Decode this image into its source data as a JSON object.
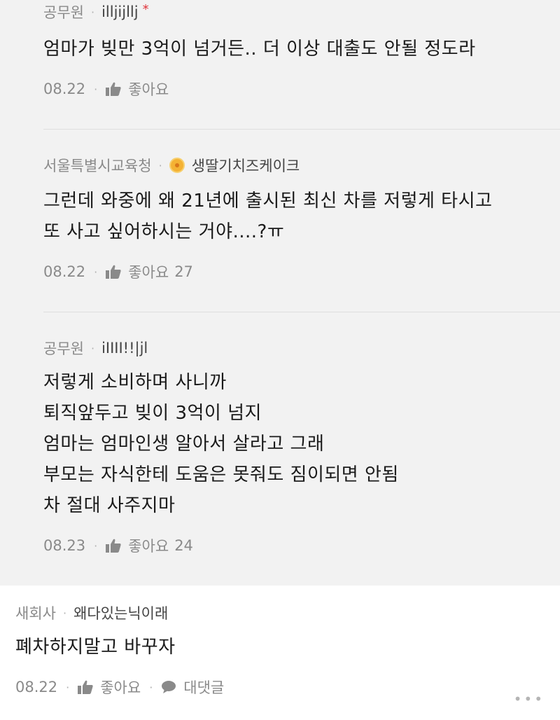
{
  "replies": [
    {
      "org": "공무원",
      "nickname": "illjijllj",
      "star": "*",
      "lines": [
        "엄마가 빚만 3억이 넘거든.. 더 이상 대출도 안될 정도라"
      ],
      "date": "08.22",
      "like_label": "좋아요",
      "like_count": ""
    },
    {
      "org": "서울특별시교육청",
      "nickname": "생딸기치즈케이크",
      "lines": [
        "그런데 와중에 왜 21년에 출시된 최신 차를 저렇게 타시고",
        "또 사고 싶어하시는 거야....?ㅠ"
      ],
      "date": "08.22",
      "like_label": "좋아요",
      "like_count": "27"
    },
    {
      "org": "공무원",
      "nickname": "iIIII!!|jl",
      "lines": [
        "저렇게 소비하며 사니까",
        "퇴직앞두고 빚이 3억이 넘지",
        "엄마는 엄마인생 알아서 살라고 그래",
        "부모는 자식한테 도움은 못줘도 짐이되면 안됨",
        "차 절대 사주지마"
      ],
      "date": "08.23",
      "like_label": "좋아요",
      "like_count": "24"
    }
  ],
  "main_comment": {
    "org": "새회사",
    "nickname": "왜다있는닉이래",
    "lines": [
      "폐차하지말고 바꾸자"
    ],
    "date": "08.22",
    "like_label": "좋아요",
    "reply_label": "대댓글",
    "more": "•••"
  }
}
